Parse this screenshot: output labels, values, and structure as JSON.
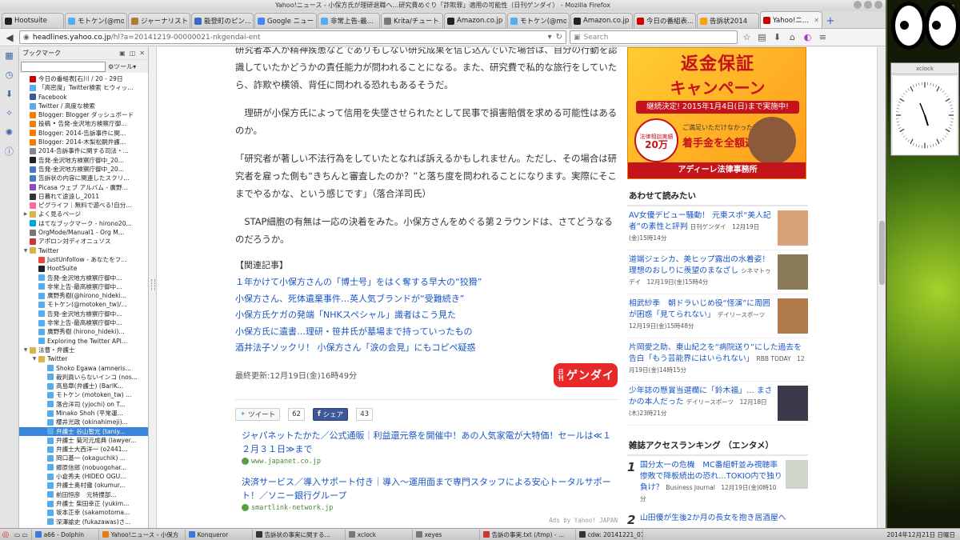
{
  "window": {
    "title": "Yahoo!ニュース - 小保方氏が理研退職へ…研究費めぐり「詐欺罪」適用の可能性（日刊ゲンダイ） - Mozilla Firefox"
  },
  "tabs": [
    {
      "label": "Hootsuite",
      "color": "#222222"
    },
    {
      "label": "モトケン(@mo...",
      "color": "#55acee"
    },
    {
      "label": "ジャーナリスト...",
      "color": "#b07a3a"
    },
    {
      "label": "能登町のピン...",
      "color": "#3a6ac4"
    },
    {
      "label": "Google ニュース",
      "color": "#4285f4"
    },
    {
      "label": "非常上告-最...",
      "color": "#55acee"
    },
    {
      "label": "Krita/チュート...",
      "color": "#777777"
    },
    {
      "label": "Amazon.co.jp...",
      "color": "#222222"
    },
    {
      "label": "モトケン(@mo...",
      "color": "#55acee"
    },
    {
      "label": "Amazon.co.jp...",
      "color": "#222222"
    },
    {
      "label": "今日の番組表...",
      "color": "#cc0000"
    },
    {
      "label": "告訴状2014",
      "color": "#f4a300"
    },
    {
      "label": "Yahoo!ニ...",
      "color": "#cc0000",
      "active": true
    }
  ],
  "navbar": {
    "url_domain": "headlines.yahoo.co.jp",
    "url_path": "/hl?a=20141219-00000021-nkgendai-ent",
    "search_placeholder": "Search"
  },
  "sidebar": {
    "title": "ブックマーク",
    "tools_label": "ツール",
    "items": [
      {
        "label": "今日の番組表[石川 / 20 - 29日",
        "color": "#cc0000",
        "indent": 0
      },
      {
        "label": "「高密度」Twitter検索 ヒウィッ...",
        "color": "#55acee",
        "indent": 0
      },
      {
        "label": "Facebook",
        "color": "#3b5998",
        "indent": 0
      },
      {
        "label": "Twitter / 高度な検索",
        "color": "#55acee",
        "indent": 0
      },
      {
        "label": "Blogger: Blogger ダッシュボード",
        "color": "#f57d00",
        "indent": 0
      },
      {
        "label": "投稿 • 告発-金沢地方検察庁御...",
        "color": "#f57d00",
        "indent": 0
      },
      {
        "label": "Blogger: 2014-告訴事件に関...",
        "color": "#f57d00",
        "indent": 0
      },
      {
        "label": "Blogger: 2014-木梨松嗣弁護...",
        "color": "#f57d00",
        "indent": 0
      },
      {
        "label": "2014-告訴事件に関する司法・...",
        "color": "#888888",
        "indent": 0
      },
      {
        "label": "告発-金沢地方検察庁御中_20...",
        "color": "#222222",
        "indent": 0
      },
      {
        "label": "告発-金沢地方検察庁御中_20...",
        "color": "#4a7ac4",
        "indent": 0
      },
      {
        "label": "告訴状の内容に関連したスクリ...",
        "color": "#4a7ac4",
        "indent": 0
      },
      {
        "label": "Picasa ウェブ アルバム - 廣野...",
        "color": "#8a4ac4",
        "indent": 0
      },
      {
        "label": "日暮れて途遠し_2011",
        "color": "#333333",
        "indent": 0
      },
      {
        "label": "ピグライフ｜無料で遊べる!自分...",
        "color": "#ff6699",
        "indent": 0
      },
      {
        "label": "よく見るページ",
        "color": "#d9b44a",
        "indent": 0,
        "folder": "closed"
      },
      {
        "label": "はてなブックマーク - hirono20...",
        "color": "#00a4de",
        "indent": 0
      },
      {
        "label": "OrgMode/Manual1 - Org M...",
        "color": "#777777",
        "indent": 0
      },
      {
        "label": "アポロン対ディオニュソス",
        "color": "#cc3333",
        "indent": 0
      },
      {
        "label": "Twitter",
        "color": "#d9b44a",
        "indent": 0,
        "folder": "open"
      },
      {
        "label": "JustUnfollow - あなたをフ...",
        "color": "#e84a3a",
        "indent": 1
      },
      {
        "label": "HootSuite",
        "color": "#222222",
        "indent": 1
      },
      {
        "label": "告発-金沢地方検察庁御中...",
        "color": "#55acee",
        "indent": 1
      },
      {
        "label": "非常上告-最高検察庁御中...",
        "color": "#55acee",
        "indent": 1
      },
      {
        "label": "廣野秀樹(@hirono_hideki...",
        "color": "#55acee",
        "indent": 1
      },
      {
        "label": "モトケン(@motoken_tw)/...",
        "color": "#55acee",
        "indent": 1
      },
      {
        "label": "告発-金沢地方検察庁御中...",
        "color": "#55acee",
        "indent": 1
      },
      {
        "label": "非常上告-最高検察庁御中...",
        "color": "#55acee",
        "indent": 1
      },
      {
        "label": "廣野秀樹 (hirono_hideki)...",
        "color": "#55acee",
        "indent": 1
      },
      {
        "label": "Exploring the Twitter API...",
        "color": "#55acee",
        "indent": 1
      },
      {
        "label": "法曹・弁護士",
        "color": "#d9b44a",
        "indent": 0,
        "folder": "open"
      },
      {
        "label": "Twitter",
        "color": "#d9b44a",
        "indent": 1,
        "folder": "open"
      },
      {
        "label": "Shoko Egawa (amneris...",
        "color": "#55acee",
        "indent": 2
      },
      {
        "label": "裁判員いらないインコ (nos...",
        "color": "#55acee",
        "indent": 2
      },
      {
        "label": "高島章(弁護士) (BarlK...",
        "color": "#55acee",
        "indent": 2
      },
      {
        "label": "モトケン (motoken_tw) ...",
        "color": "#55acee",
        "indent": 2
      },
      {
        "label": "落合洋司 (yjochi) on T...",
        "color": "#55acee",
        "indent": 2
      },
      {
        "label": "Minako Shoh (平常運...",
        "color": "#55acee",
        "indent": 2
      },
      {
        "label": "櫻井光政 (okinahimeji)...",
        "color": "#55acee",
        "indent": 2
      },
      {
        "label": "弁護士 谷山智光 (taniy...",
        "color": "#55acee",
        "indent": 2,
        "selected": true
      },
      {
        "label": "弁護士 菊河元成典 (lawyer...",
        "color": "#55acee",
        "indent": 2
      },
      {
        "label": "弁護士大西洋一 (o2441...",
        "color": "#55acee",
        "indent": 2
      },
      {
        "label": "岡口基一 (okaguchik) ...",
        "color": "#55acee",
        "indent": 2
      },
      {
        "label": "郷原信郎 (nobuogohar...",
        "color": "#55acee",
        "indent": 2
      },
      {
        "label": "小倉秀夫 (HIDEO OGU...",
        "color": "#55acee",
        "indent": 2
      },
      {
        "label": "弁護士奥村徹 (okumur...",
        "color": "#55acee",
        "indent": 2
      },
      {
        "label": "前田恒彦　元特捜部...",
        "color": "#55acee",
        "indent": 2
      },
      {
        "label": "弁護士 柴田幸正 (yukim...",
        "color": "#55acee",
        "indent": 2
      },
      {
        "label": "坂本正幸 (sakamotoma...",
        "color": "#55acee",
        "indent": 2
      },
      {
        "label": "深澤諭史 (fukazawas)さ...",
        "color": "#55acee",
        "indent": 2
      }
    ]
  },
  "article": {
    "partial_top": "研究者本人が精神疾患などでありもしない研究成果を信じ込んでいた場合は、自分の行動を認識していたかどうかの責任能力が問われることになる。また、研究費で私的な旅行をしていたら、詐欺や横領、背任に問われる恐れもあるそうだ。",
    "paragraphs": [
      "理研が小保方氏によって信用を失墜させられたとして民事で損害賠償を求める可能性はあるのか。",
      "「研究者が著しい不法行為をしていたとなれば訴えるかもしれません。ただし、その場合は研究者を雇った側も“きちんと審査したのか？”と落ち度を問われることになります。実際にそこまでやるかな、という感じです」（落合洋司氏）",
      "STAP細胞の有無は一応の決着をみた。小保方さんをめぐる第２ラウンドは、さてどうなるのだろうか。"
    ],
    "related_heading": "【関連記事】",
    "related": [
      "１年かけて小保方さんの「博士号」をはく奪する早大の“狡猾”",
      "小保方さん、死体遺棄事件…英人気ブランドが“受難続き”",
      "小保方氏ケガの発端「NHKスペシャル」識者はこう見た",
      "小保方氏に遺書…理研・笹井氏が墓場まで持っていったもの",
      "酒井法子ソックリ！ 小保方さん「涙の会見」にもコピペ疑惑"
    ],
    "last_updated": "最終更新:12月19日(金)16時49分",
    "source_logo": "ゲンダイ",
    "source_logo_small": "日刊",
    "tweet_label": "ツイート",
    "tweet_count": "62",
    "share_label": "シェア",
    "share_count": "43",
    "ads": [
      {
        "title": "ジャパネットたかた／公式通販｜利益還元祭を開催中！あの人気家電が大特価！セールは≪１２月３１日≫まで",
        "url": "www.japanet.co.jp"
      },
      {
        "title": "決済サービス／導入サポート付き｜導入～運用面まで専門スタッフによる安心トータルサポート！／ソニー銀行グループ",
        "url": "smartlink-network.jp"
      }
    ],
    "ads_by": "Ads by Yahoo! JAPAN"
  },
  "banner": {
    "line1": "返金保証",
    "line2": "キャンペーン",
    "line3": "継続決定! 2015年1月4日(日)まで実施中!",
    "badge": "20万",
    "badge_label": "法律相談実績",
    "line5": "ご満足いただけなかった場合は",
    "line6": "着手金を全額返金",
    "footer": "アディーレ法律事務所"
  },
  "related_news": {
    "heading": "あわせて読みたい",
    "items": [
      {
        "title": "AV女優デビュー騒動！ 元東スポ“美人記者”の素性と評判",
        "source": "日刊ゲンダイ　12月19日(金)15時14分",
        "thumb": "#d8a27a"
      },
      {
        "title": "道端ジェシカ、美ヒップ露出の水着姿！理想のおしりに羨望のまなざし",
        "source": "シネマトゥデイ　12月19日(金)15時4分",
        "thumb": "#8a7a5a"
      },
      {
        "title": "相武紗季　朝ドラいじめ役“怪演”に周囲が困惑「見てられない」",
        "source": "デイリースポーツ　12月19日(金)15時48分",
        "thumb": "#b07a4a"
      },
      {
        "title": "片岡愛之助、東山紀之を“病院送り”にした過去を告白「もう芸能界にはいられない」",
        "source": "RBB TODAY　12月19日(金)14時15分",
        "thumb": ""
      },
      {
        "title": "少年誌の懸賞当選欄に「鈴木福」… まさかの本人だった",
        "source": "デイリースポーツ　12月18日(木)23時21分",
        "thumb": "#3a3a4a"
      }
    ]
  },
  "ranking": {
    "heading": "雑誌アクセスランキング （エンタメ）",
    "items": [
      {
        "rank": "1",
        "title": "国分太一の危機　MC番組軒並み視聴率惨敗で降板続出の恐れ…TOKIO内で独り負け？",
        "source": "Business Journal　12月19日(金)0時10分"
      },
      {
        "rank": "2",
        "title": "山田優が生後2か月の長女を抱き居酒屋へ",
        "source": ""
      }
    ]
  },
  "taskbar": {
    "tasks": [
      {
        "label": "a66 - Dolphin",
        "color": "#3a7ad9"
      },
      {
        "label": "Yahoo!ニュース - 小保方",
        "color": "#e87a1a"
      },
      {
        "label": "Konqueror",
        "color": "#3a7ad9"
      },
      {
        "label": "告訴状の事実に関する...",
        "color": "#333333"
      },
      {
        "label": "xclock",
        "color": "#777777"
      },
      {
        "label": "xeyes",
        "color": "#777777"
      },
      {
        "label": "告訴の事実.txt (/tmp) - ...",
        "color": "#cc3333"
      },
      {
        "label": "cdw: 20141221_0723",
        "color": "#333333"
      }
    ],
    "clock": "2014年12月21日 日曜日"
  },
  "desktop": {
    "xclock_title": "xclock",
    "label": "Des"
  }
}
